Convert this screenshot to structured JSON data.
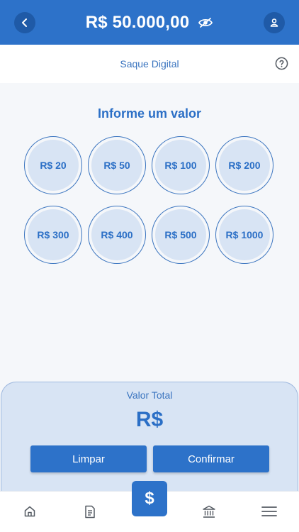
{
  "header": {
    "balance": "R$ 50.000,00",
    "back_icon": "chevron-left-icon",
    "visibility_icon": "eye-off-icon",
    "profile_icon": "user-icon"
  },
  "subheader": {
    "title": "Saque Digital",
    "help_icon": "help-circle-icon"
  },
  "main": {
    "prompt": "Informe um valor",
    "amounts": [
      "R$ 20",
      "R$ 50",
      "R$ 100",
      "R$ 200",
      "R$ 300",
      "R$ 400",
      "R$ 500",
      "R$ 1000"
    ]
  },
  "summary": {
    "label": "Valor Total",
    "value": "R$",
    "clear_label": "Limpar",
    "confirm_label": "Confirmar"
  },
  "nav": {
    "fab_symbol": "$",
    "items": [
      "home-icon",
      "document-icon",
      "withdraw-icon",
      "bank-icon",
      "menu-icon"
    ]
  },
  "colors": {
    "primary": "#2d72c9",
    "primary_dark": "#1f5aa7",
    "text_blue": "#2b6fc6",
    "coin_fill": "#d8e4f4",
    "background": "#f5f7fa"
  }
}
